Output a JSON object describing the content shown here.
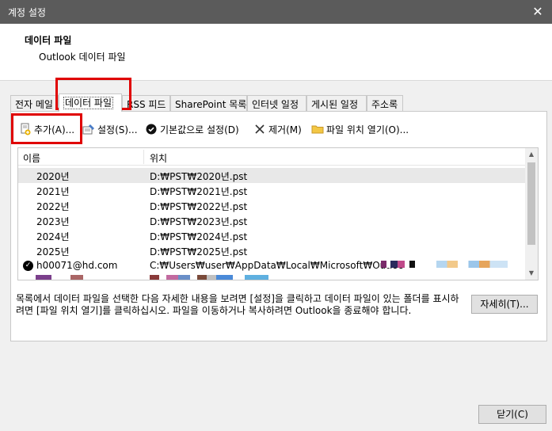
{
  "window": {
    "title": "계정 설정",
    "close_glyph": "✕"
  },
  "header": {
    "title": "데이터 파일",
    "subtitle": "Outlook 데이터 파일"
  },
  "tabs": [
    {
      "label": "전자 메일"
    },
    {
      "label": "데이터 파일"
    },
    {
      "label": "RSS 피드"
    },
    {
      "label": "SharePoint 목록"
    },
    {
      "label": "인터넷 일정"
    },
    {
      "label": "게시된 일정"
    },
    {
      "label": "주소록"
    }
  ],
  "toolbar": {
    "add": {
      "label": "추가(A)...",
      "icon": "add-file-icon"
    },
    "settings": {
      "label": "설정(S)...",
      "icon": "settings-icon"
    },
    "default": {
      "label": "기본값으로 설정(D)",
      "icon": "check-circle-icon"
    },
    "remove": {
      "label": "제거(M)",
      "icon": "remove-x-icon"
    },
    "open_location": {
      "label": "파일 위치 열기(O)...",
      "icon": "folder-icon"
    }
  },
  "list": {
    "columns": [
      "이름",
      "위치"
    ],
    "rows": [
      {
        "name": "2020년",
        "path": "D:₩PST₩2020년.pst"
      },
      {
        "name": "2021년",
        "path": "D:₩PST₩2021년.pst"
      },
      {
        "name": "2022년",
        "path": "D:₩PST₩2022년.pst"
      },
      {
        "name": "2023년",
        "path": "D:₩PST₩2023년.pst"
      },
      {
        "name": "2024년",
        "path": "D:₩PST₩2024년.pst"
      },
      {
        "name": "2025년",
        "path": "D:₩PST₩2025년.pst"
      },
      {
        "name": "h00071@hd.com",
        "path": "C:₩Users₩user₩AppData₩Local₩Microsoft₩Outloo"
      }
    ]
  },
  "description": "목록에서 데이터 파일을 선택한 다음 자세한 내용을 보려면 [설정]을 클릭하고 데이터 파일이 있는 폴더를 표시하려면 [파일 위치 열기]를 클릭하십시오. 파일을 이동하거나 복사하려면 Outlook을 종료해야 합니다.",
  "buttons": {
    "details": "자세히(T)...",
    "close": "닫기(C)"
  }
}
